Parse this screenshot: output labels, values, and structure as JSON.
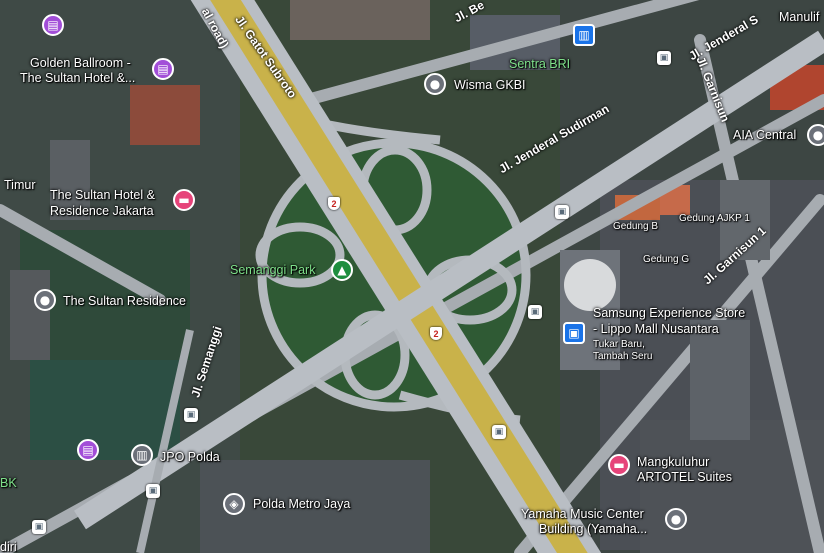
{
  "places": {
    "golden_ballroom": "Golden Ballroom -",
    "golden_ballroom_2": "The Sultan Hotel &...",
    "sultan_hotel": "The Sultan Hotel &",
    "sultan_hotel_2": "Residence Jakarta",
    "sultan_residence": "The Sultan Residence",
    "semanggi_park": "Semanggi Park",
    "jpo_polda": "JPO Polda",
    "polda_metro_jaya": "Polda Metro Jaya",
    "wisma_gkbi": "Wisma GKBI",
    "sentra_bri": "Sentra BRI",
    "manulife": "Manulif",
    "aia_central": "AIA Central",
    "gedung_b": "Gedung B",
    "gedung_ajkp": "Gedung AJKP 1",
    "gedung_g": "Gedung G",
    "samsung": "Samsung Experience Store",
    "samsung_2": "- Lippo Mall Nusantara",
    "samsung_sub": "Tukar Baru,",
    "samsung_sub_2": "Tambah Seru",
    "mangkuluhur": "Mangkuluhur",
    "mangkuluhur_2": "ARTOTEL Suites",
    "yamaha": "Yamaha Music Center",
    "yamaha_2": "Building (Yamaha...",
    "timur": "Timur",
    "bk": "BK",
    "diri": "diri"
  },
  "roads": {
    "gatot_subroto": "Jl. Gatot Subroto",
    "gatot_road": "al road)",
    "sudirman": "Jl. Jenderal Sudirman",
    "jenderal_top": "Jl. Jenderal S",
    "garnisun": "Jl. Garnisun",
    "garnisun_1": "Jl. Garnisun 1",
    "semanggi": "Jl. Semanggi",
    "be": "Jl. Be"
  },
  "shields": {
    "route": "2"
  },
  "icons": {
    "hotel": "hotel-icon",
    "event": "event-venue-icon",
    "park": "park-tree-icon",
    "bus": "bus-stop-icon",
    "building": "building-icon",
    "shopping": "shopping-icon"
  },
  "colors": {
    "pin_purple": "#a24ed8",
    "pin_pink": "#e6447a",
    "pin_grey": "#6b7079",
    "park_green": "#1e8e3e",
    "highway": "#c9b24a",
    "road": "#b9bec4"
  }
}
